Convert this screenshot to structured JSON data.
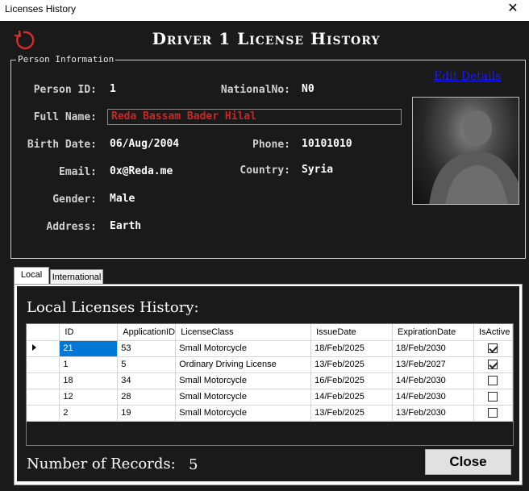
{
  "window": {
    "title": "Licenses History",
    "close_glyph": "✕"
  },
  "header": {
    "title": "Driver 1 License History",
    "refresh_icon": "refresh-icon"
  },
  "person_info": {
    "legend": "Person Information",
    "labels": {
      "person_id": "Person ID:",
      "full_name": "Full Name:",
      "birth_date": "Birth Date:",
      "email": "Email:",
      "gender": "Gender:",
      "address": "Address:",
      "national_no": "NationalNo:",
      "phone": "Phone:",
      "country": "Country:"
    },
    "values": {
      "person_id": "1",
      "full_name": "Reda Bassam Bader Hilal",
      "birth_date": "06/Aug/2004",
      "email": "0x@Reda.me",
      "gender": "Male",
      "address": "Earth",
      "national_no": "N0",
      "phone": "10101010",
      "country": "Syria"
    },
    "edit_link": "Edit Details",
    "accent_color": "#c62828"
  },
  "tabs": [
    {
      "label": "Local",
      "active": true
    },
    {
      "label": "International",
      "active": false
    }
  ],
  "local_history": {
    "title": "Local Licenses History:",
    "columns": [
      "ID",
      "ApplicationID",
      "LicenseClass",
      "IssueDate",
      "ExpirationDate",
      "IsActive"
    ],
    "rows": [
      {
        "id": "21",
        "application_id": "53",
        "license_class": "Small Motorcycle",
        "issue_date": "18/Feb/2025",
        "expiration_date": "18/Feb/2030",
        "is_active": true
      },
      {
        "id": "1",
        "application_id": "5",
        "license_class": "Ordinary Driving License",
        "issue_date": "13/Feb/2025",
        "expiration_date": "13/Feb/2027",
        "is_active": true
      },
      {
        "id": "18",
        "application_id": "34",
        "license_class": "Small Motorcycle",
        "issue_date": "16/Feb/2025",
        "expiration_date": "14/Feb/2030",
        "is_active": false
      },
      {
        "id": "12",
        "application_id": "28",
        "license_class": "Small Motorcycle",
        "issue_date": "14/Feb/2025",
        "expiration_date": "14/Feb/2030",
        "is_active": false
      },
      {
        "id": "2",
        "application_id": "19",
        "license_class": "Small Motorcycle",
        "issue_date": "13/Feb/2025",
        "expiration_date": "13/Feb/2030",
        "is_active": false
      }
    ],
    "records_label": "Number of Records:",
    "records_count": "5",
    "selection_color": "#0078d7"
  },
  "footer": {
    "close_label": "Close"
  }
}
